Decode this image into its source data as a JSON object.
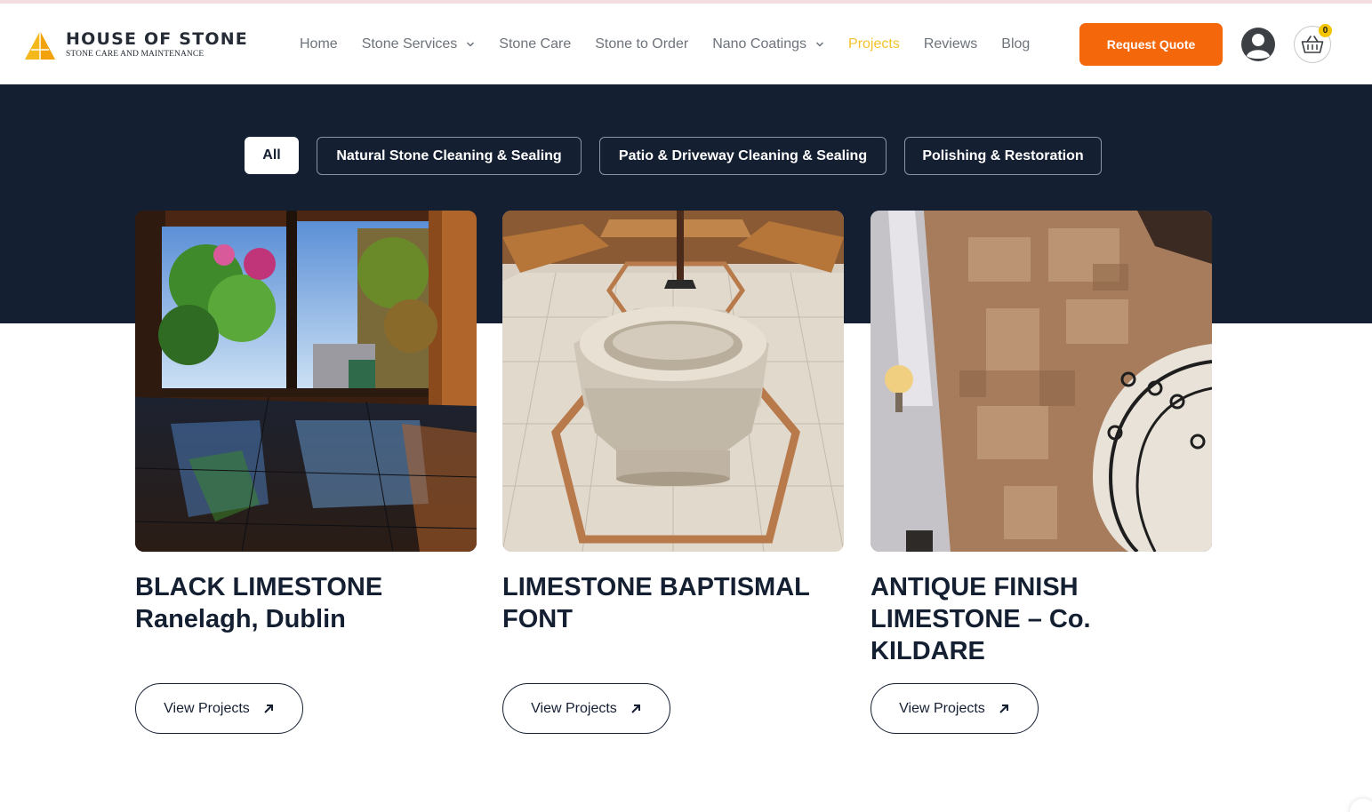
{
  "brand": {
    "title": "HOUSE OF STONE",
    "subtitle": "STONE CARE AND MAINTENANCE"
  },
  "nav": {
    "items": [
      {
        "label": "Home",
        "has_dropdown": false,
        "active": false
      },
      {
        "label": "Stone Services",
        "has_dropdown": true,
        "active": false
      },
      {
        "label": "Stone Care",
        "has_dropdown": false,
        "active": false
      },
      {
        "label": "Stone to Order",
        "has_dropdown": false,
        "active": false
      },
      {
        "label": "Nano Coatings",
        "has_dropdown": true,
        "active": false
      },
      {
        "label": "Projects",
        "has_dropdown": false,
        "active": true
      },
      {
        "label": "Reviews",
        "has_dropdown": false,
        "active": false
      },
      {
        "label": "Blog",
        "has_dropdown": false,
        "active": false
      }
    ],
    "cta_label": "Request Quote",
    "cart_count": "0",
    "icons": [
      "user-avatar-icon",
      "shopping-basket-icon"
    ]
  },
  "filters": {
    "items": [
      {
        "label": "All",
        "active": true
      },
      {
        "label": "Natural Stone Cleaning & Sealing",
        "active": false
      },
      {
        "label": "Patio & Driveway Cleaning & Sealing",
        "active": false
      },
      {
        "label": "Polishing & Restoration",
        "active": false
      }
    ]
  },
  "projects": [
    {
      "title": "BLACK LIMESTONE Ranelagh, Dublin",
      "button": "View Projects",
      "image": "black-limestone-floor-garden-doors"
    },
    {
      "title": "LIMESTONE BAPTISMAL FONT",
      "button": "View Projects",
      "image": "limestone-baptismal-font"
    },
    {
      "title": "ANTIQUE FINISH LIMESTONE – Co. KILDARE",
      "button": "View Projects",
      "image": "antique-limestone-staircase"
    }
  ],
  "colors": {
    "accent_orange": "#f4670a",
    "active_nav_yellow": "#f3c22a",
    "hero_navy": "#141f32",
    "nav_gray": "#6d737b"
  }
}
